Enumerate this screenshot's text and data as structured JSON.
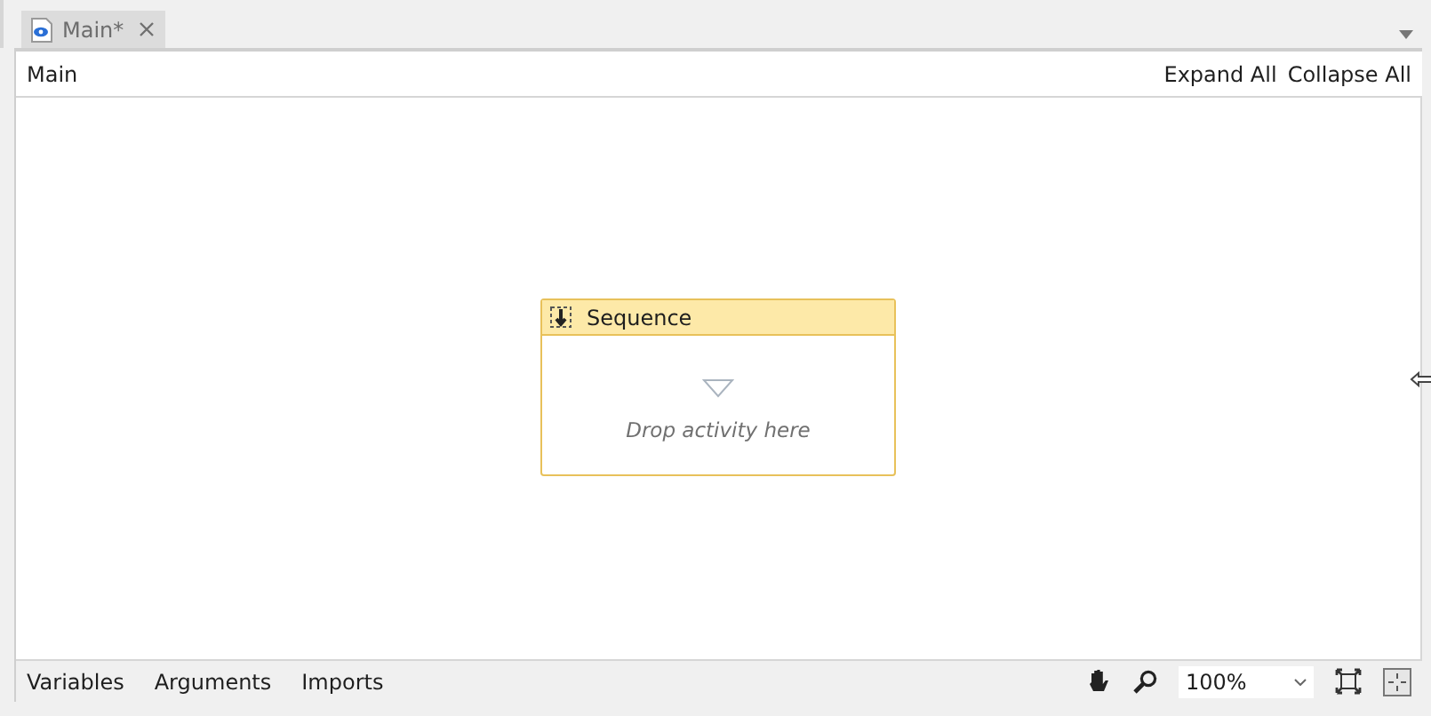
{
  "tabs": [
    {
      "label": "Main*",
      "selected": true
    }
  ],
  "header": {
    "title": "Main",
    "actions": [
      "Expand All",
      "Collapse All"
    ]
  },
  "activity": {
    "title": "Sequence",
    "hint": "Drop activity here"
  },
  "footer": {
    "tabs": [
      "Variables",
      "Arguments",
      "Imports"
    ],
    "zoom": "100%"
  }
}
